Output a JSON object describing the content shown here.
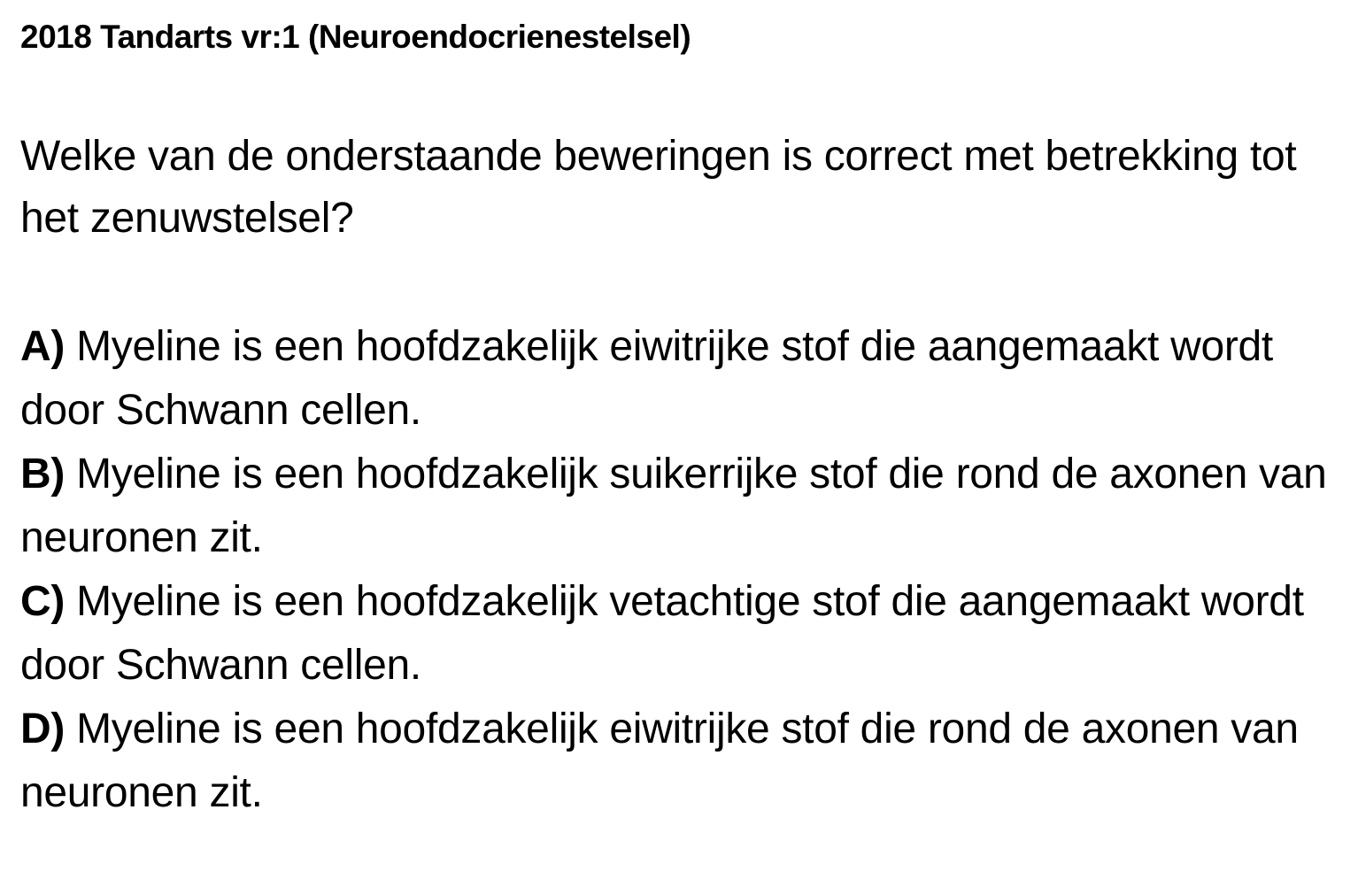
{
  "title": "2018 Tandarts vr:1 (Neuroendocrienestelsel)",
  "question": "Welke van de onderstaande beweringen is correct met betrekking tot het zenuwstelsel?",
  "options": [
    {
      "letter": "A)",
      "text": "Myeline is een hoofdzakelijk eiwitrijke stof die aangemaakt wordt door Schwann cellen."
    },
    {
      "letter": "B)",
      "text": "Myeline is een hoofdzakelijk suikerrijke stof die rond de axonen van neuronen zit."
    },
    {
      "letter": "C)",
      "text": "Myeline is een hoofdzakelijk vetachtige stof die aangemaakt wordt door Schwann cellen."
    },
    {
      "letter": "D)",
      "text": "Myeline is een hoofdzakelijk eiwitrijke stof die rond de axonen van neuronen zit."
    }
  ]
}
